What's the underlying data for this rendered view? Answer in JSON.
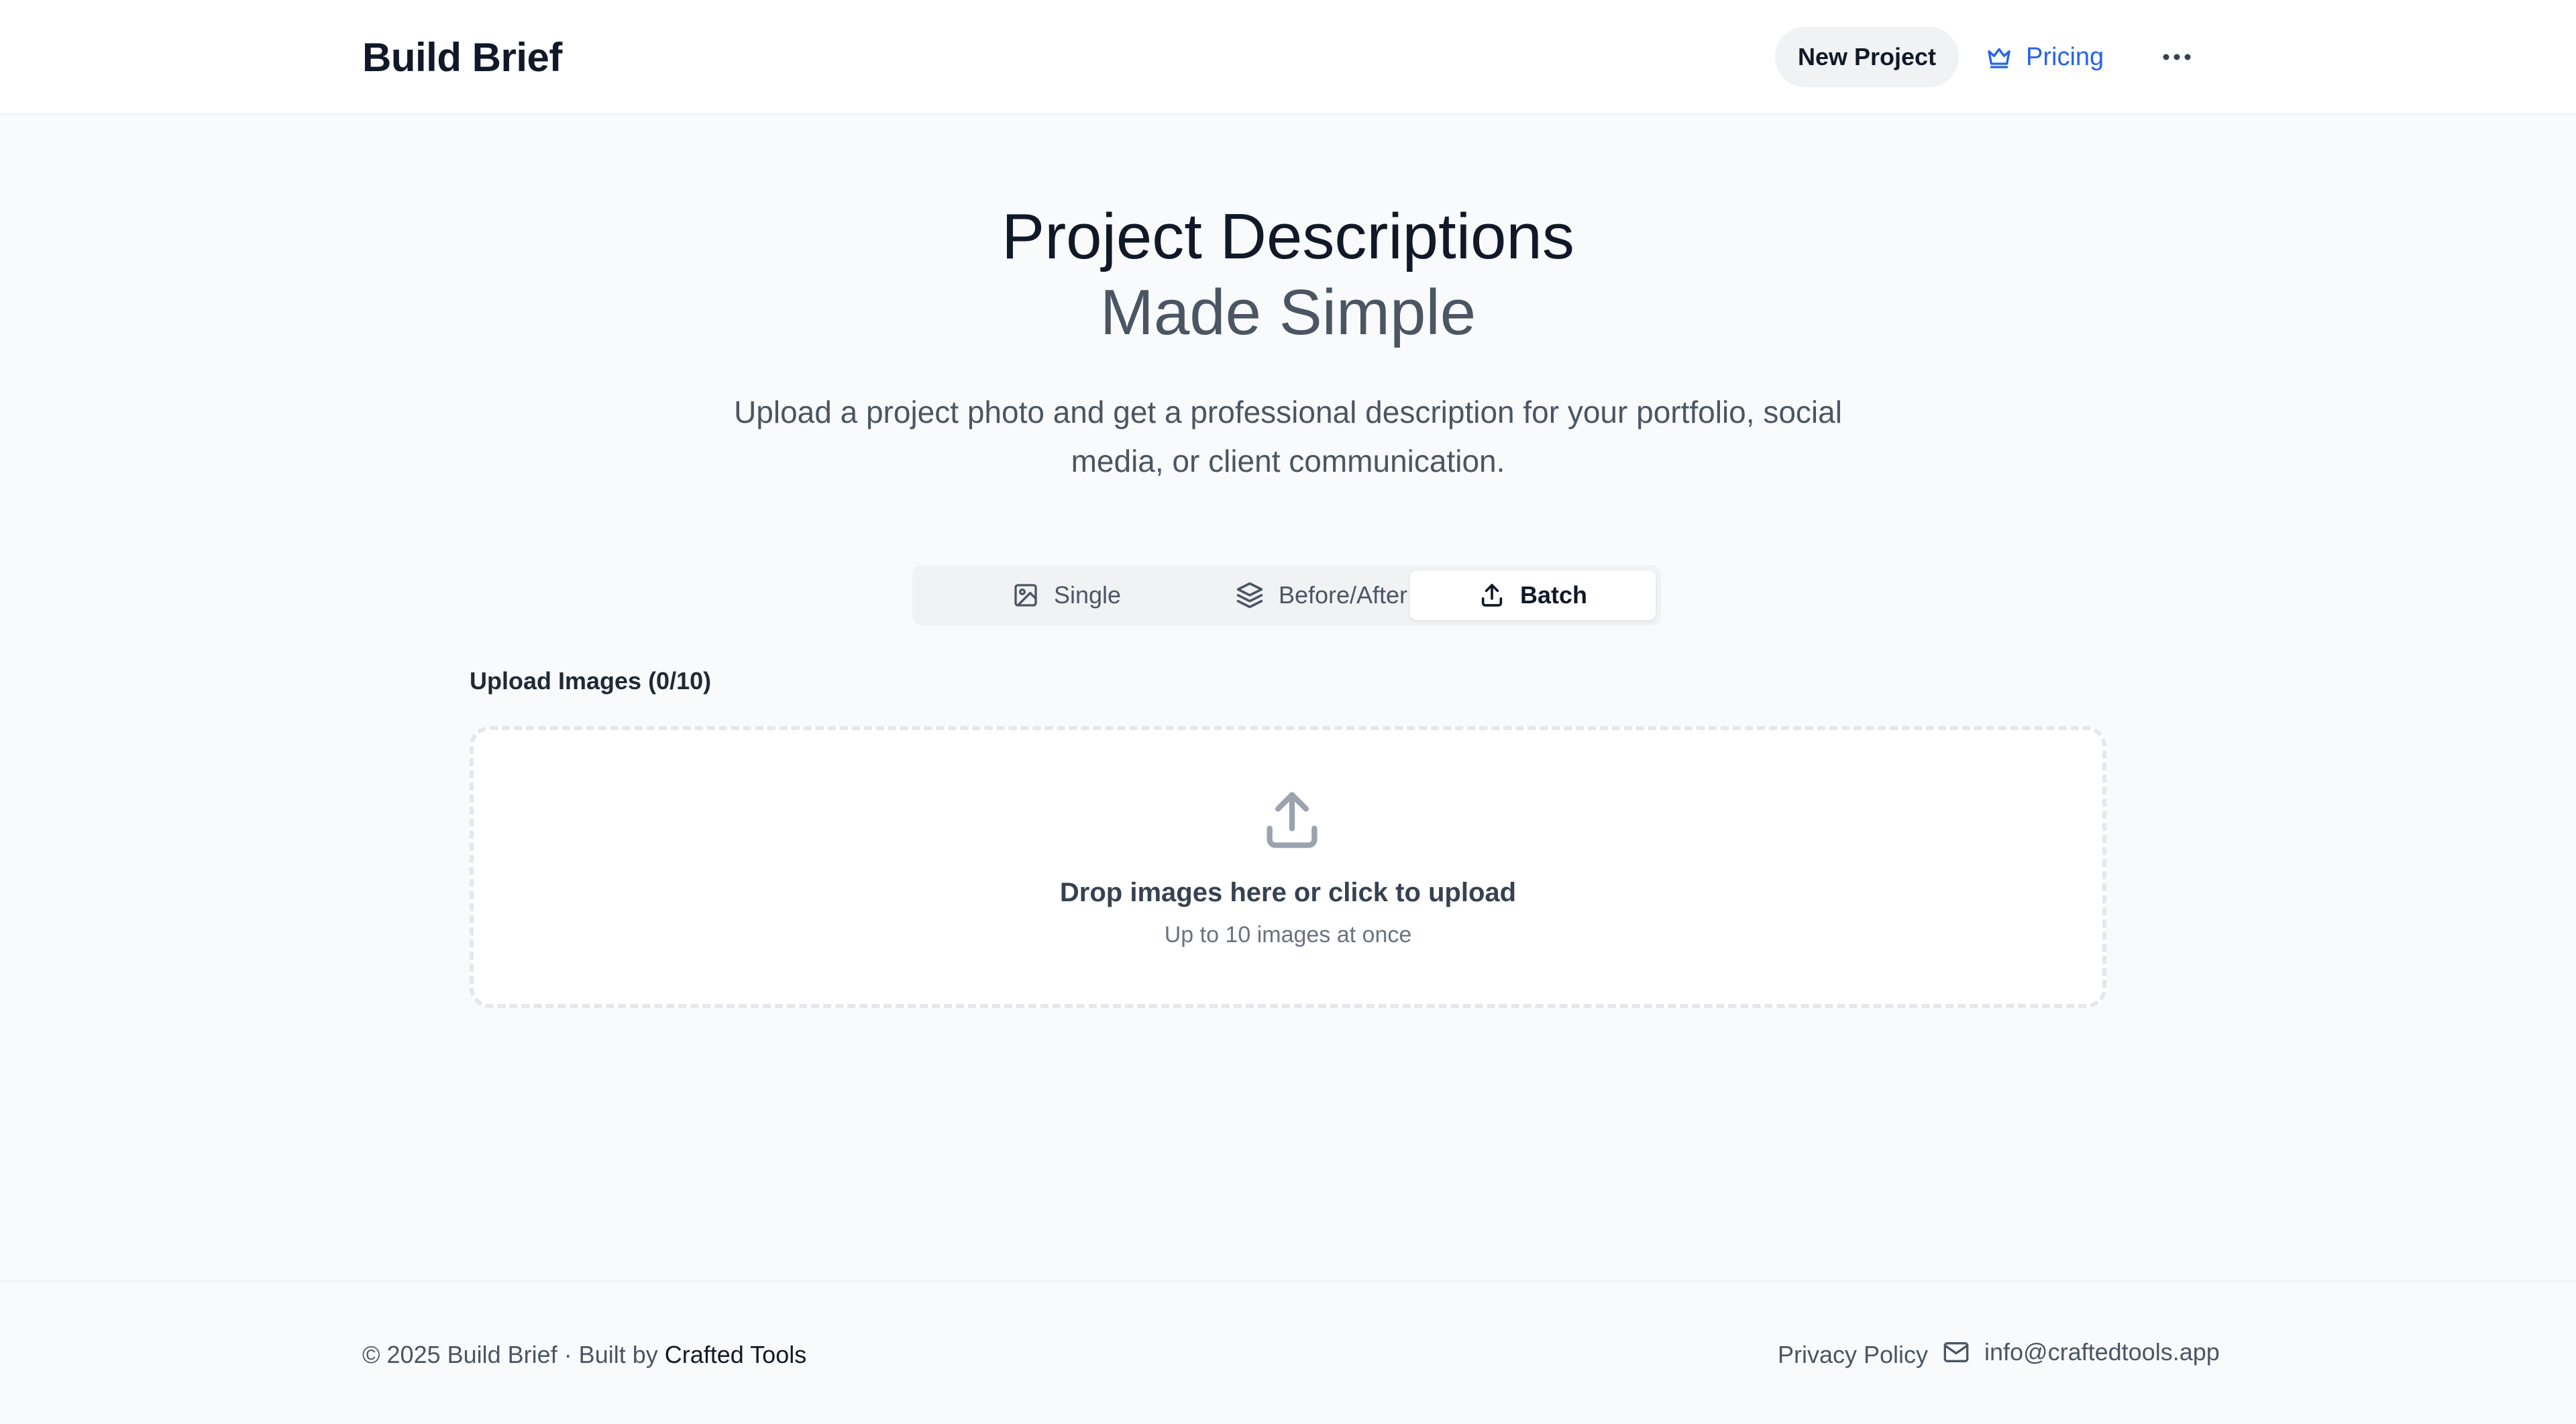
{
  "header": {
    "brand": "Build Brief",
    "new_project_label": "New Project",
    "pricing_label": "Pricing",
    "more_icon": "more-horizontal-icon"
  },
  "hero": {
    "title": "Project Descriptions",
    "subtitle": "Made Simple",
    "description": "Upload a project photo and get a professional description for your portfolio, social media, or client communication."
  },
  "tabs": [
    {
      "label": "Single",
      "icon": "image-icon",
      "active": false
    },
    {
      "label": "Before/After",
      "icon": "layers-icon",
      "active": false
    },
    {
      "label": "Batch",
      "icon": "upload-icon",
      "active": true
    }
  ],
  "upload": {
    "label": "Upload Images (0/10)",
    "drop_title": "Drop images here or click to upload",
    "drop_subtitle": "Up to 10 images at once",
    "icon": "upload-icon"
  },
  "footer": {
    "copyright": "© 2025 Build Brief · Built by",
    "credit_link": "Crafted Tools",
    "privacy_label": "Privacy Policy",
    "email": "info@craftedtools.app",
    "email_icon": "mail-icon"
  },
  "colors": {
    "accent": "#2563eb",
    "background": "#f9fafb",
    "surface": "#ffffff",
    "text_primary": "#111827",
    "text_muted": "#4b5563"
  }
}
